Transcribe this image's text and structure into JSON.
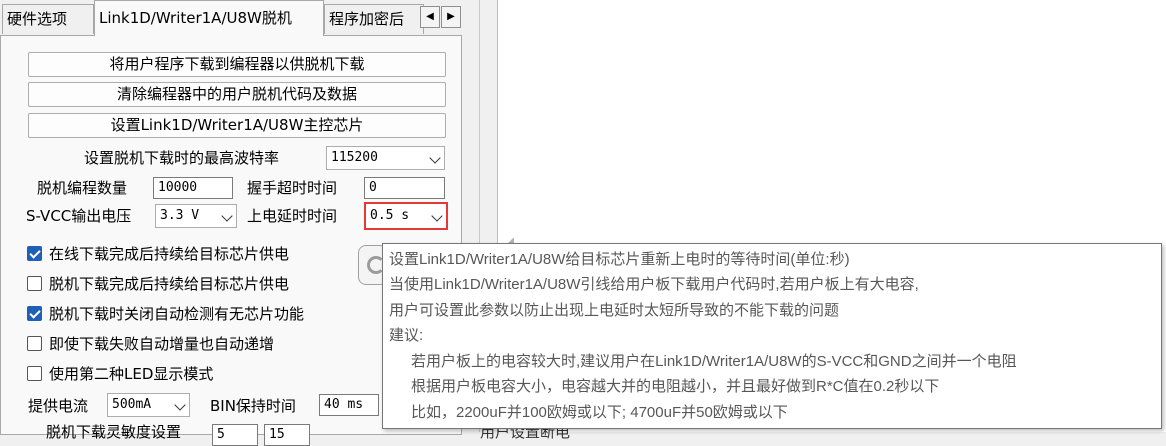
{
  "tabs": [
    {
      "label": "硬件选项"
    },
    {
      "label": "Link1D/Writer1A/U8W脱机"
    },
    {
      "label": "程序加密后"
    }
  ],
  "tab_scroll": {
    "left_icon": "◀",
    "right_icon": "▶"
  },
  "buttons": {
    "download_to_programmer": "将用户程序下载到编程器以供脱机下载",
    "clear_offline_code": "清除编程器中的用户脱机代码及数据",
    "set_main_chip": "设置Link1D/Writer1A/U8W主控芯片"
  },
  "settings": {
    "max_baud_label": "设置脱机下载时的最高波特率",
    "max_baud_value": "115200",
    "program_count_label": "脱机编程数量",
    "program_count_value": "10000",
    "handshake_timeout_label": "握手超时时间",
    "handshake_timeout_value": "0",
    "svcc_label": "S-VCC输出电压",
    "svcc_value": "3.3 V",
    "power_delay_label": "上电延时时间",
    "power_delay_value": "0.5 s"
  },
  "checkboxes": [
    {
      "label": "在线下载完成后持续给目标芯片供电",
      "checked": true
    },
    {
      "label": "脱机下载完成后持续给目标芯片供电",
      "checked": false
    },
    {
      "label": "脱机下载时关闭自动检测有无芯片功能",
      "checked": true
    },
    {
      "label": "即使下载失败自动增量也自动递增",
      "checked": false
    },
    {
      "label": "使用第二种LED显示模式",
      "checked": false
    }
  ],
  "supply": {
    "current_label": "提供电流",
    "current_value": "500mA",
    "bin_hold_label": "BIN保持时间",
    "bin_hold_value": "40 ms"
  },
  "cutoff_row": {
    "label_partial": "脱机下载灵敏度设置",
    "value_a": "5",
    "value_b": "15",
    "right_partial": "用户设置断电"
  },
  "tooltip": {
    "lines": [
      "设置Link1D/Writer1A/U8W给目标芯片重新上电时的等待时间(单位:秒)",
      "当使用Link1D/Writer1A/U8W引线给用户板下载用户代码时,若用户板上有大电容,",
      "用户可设置此参数以防止出现上电延时太短所导致的不能下载的问题",
      "建议:",
      "若用户板上的电容较大时,建议用户在Link1D/Writer1A/U8W的S-VCC和GND之间并一个电阻",
      "根据用户板电容大小，电容越大并的电阻越小，并且最好做到R*C值在0.2秒以下",
      "比如，2200uF并100欧姆或以下; 4700uF并50欧姆或以下"
    ]
  },
  "colors": {
    "checkbox_checked": "#1e5fb8",
    "highlight_border": "#e53935",
    "tooltip_text": "#575757"
  }
}
